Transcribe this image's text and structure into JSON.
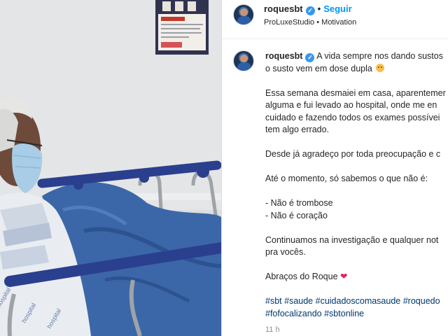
{
  "post": {
    "username": "roquesbt",
    "verified_icon": "verified-badge-icon",
    "follow_label": "Seguir",
    "location_brand": "ProLuxeStudio",
    "location_sep": "•",
    "location_category": "Motivation",
    "caption_user": "roquesbt",
    "caption_lines": [
      "A vida sempre nos dando sustos",
      "o susto vem em dose dupla"
    ],
    "paragraphs": [
      [
        "Essa semana desmaiei em casa, aparentemer",
        "alguma e fui levado ao hospital, onde me en",
        "cuidado e fazendo todos os exames possívei",
        "tem algo errado."
      ],
      [
        "Desde já agradeço por toda preocupação e c"
      ],
      [
        "Até o momento, só sabemos o que não é:"
      ],
      [
        "- Não é trombose",
        "- Não é coração"
      ],
      [
        "Continuamos na investigação e qualquer not",
        "pra vocês."
      ]
    ],
    "signoff": "Abraços do Roque",
    "hashtags_line1": [
      "#sbt",
      "#saude",
      "#cuidadoscomasaude",
      "#roquedo"
    ],
    "hashtags_line2": [
      "#fofocalizando",
      "#sbtonline"
    ],
    "time": "11 h"
  },
  "colors": {
    "follow_blue": "#0095f6",
    "hashtag": "#00376b",
    "heart": "#e0245e",
    "verified": "#3897f0"
  }
}
